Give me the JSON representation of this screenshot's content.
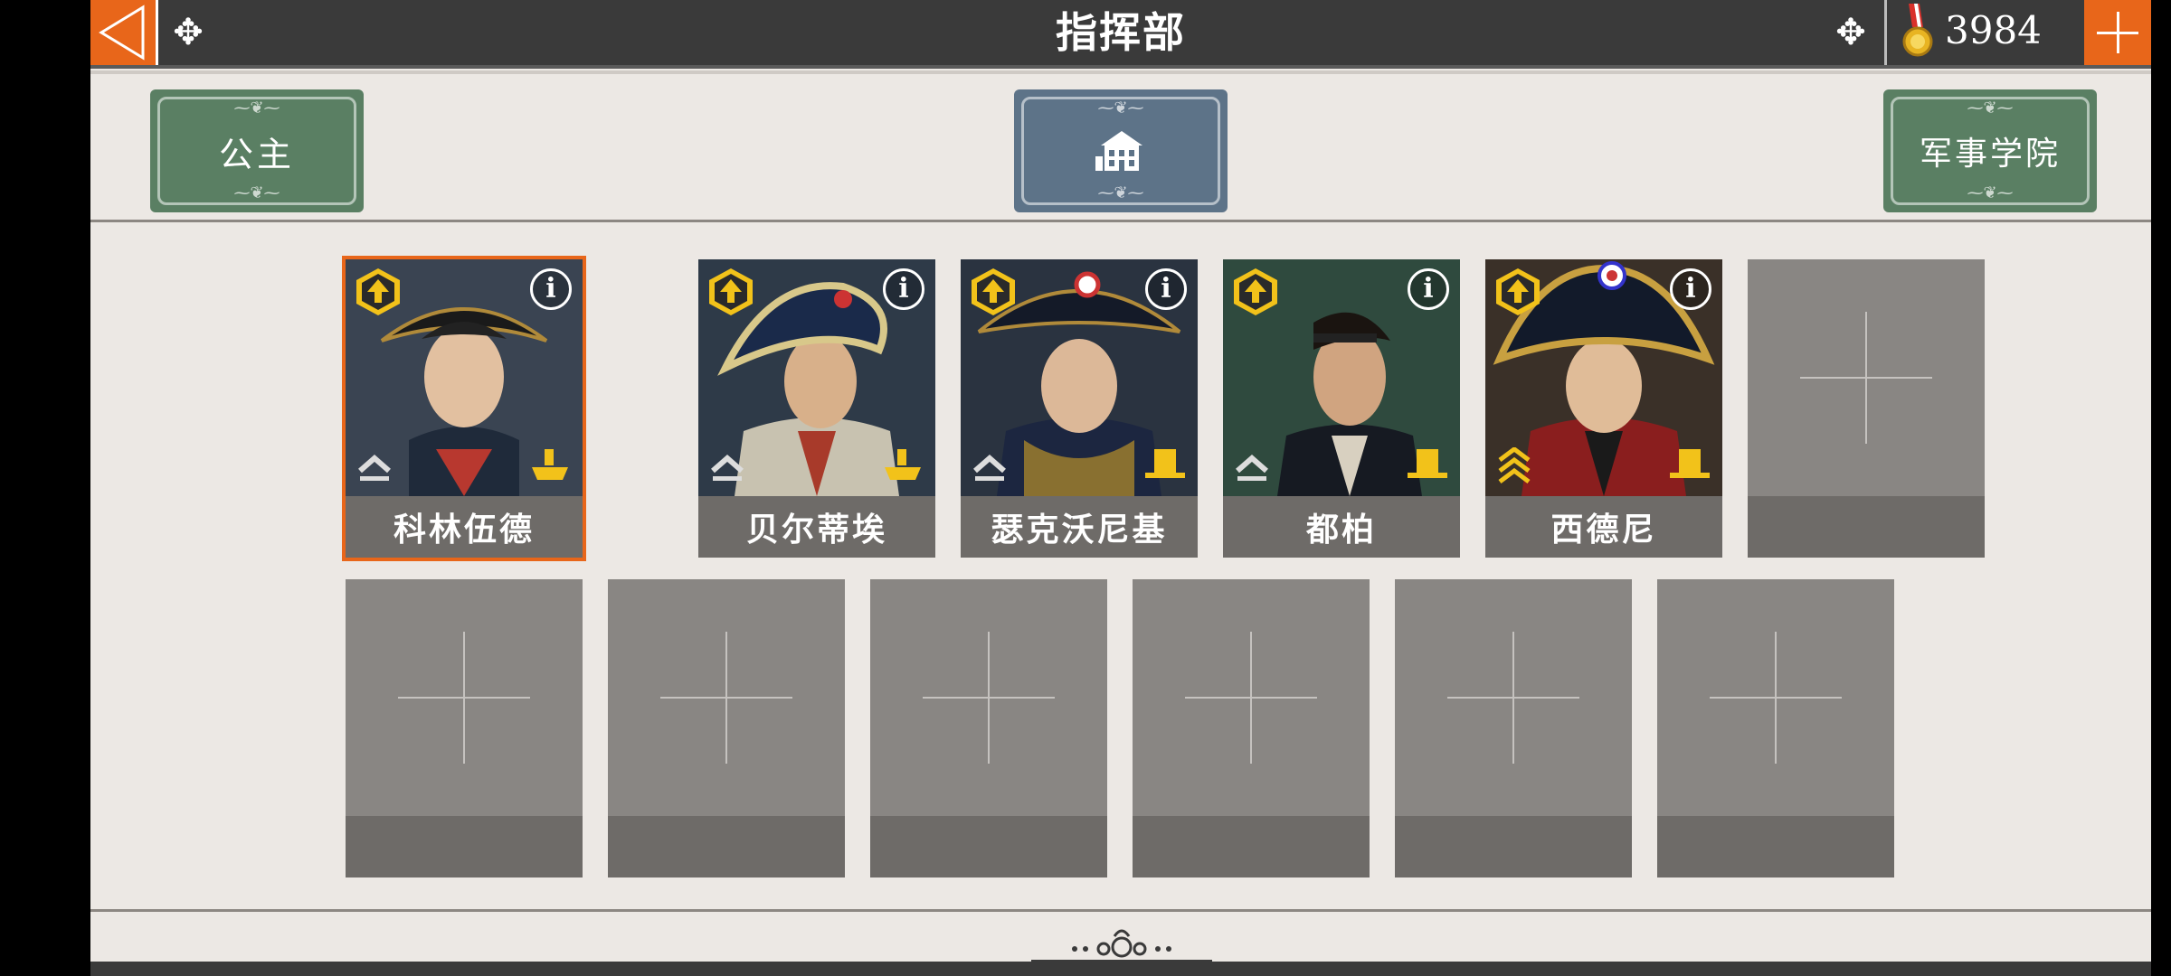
{
  "header": {
    "title": "指挥部",
    "gold_amount": "3984",
    "back_icon": "back-arrow-icon",
    "add_icon": "plus-icon",
    "medal_icon": "gold-medal-icon"
  },
  "nav": {
    "left_button": "公主",
    "center_icon": "building-icon",
    "right_button": "军事学院"
  },
  "generals": [
    {
      "name": "科林伍德",
      "rank": "rank-single-chevron-icon",
      "branch": "navy-ship-icon",
      "selected": true
    },
    {
      "name": "贝尔蒂埃",
      "rank": "rank-single-chevron-icon",
      "branch": "navy-ship-icon",
      "selected": false
    },
    {
      "name": "瑟克沃尼基",
      "rank": "rank-single-chevron-icon",
      "branch": "army-hat-icon",
      "selected": false
    },
    {
      "name": "都柏",
      "rank": "rank-single-chevron-icon",
      "branch": "army-hat-icon",
      "selected": false
    },
    {
      "name": "西德尼",
      "rank": "rank-triple-chevron-icon",
      "branch": "army-hat-icon",
      "selected": false
    }
  ],
  "empty_slots": 7,
  "colors": {
    "accent": "#e8661a",
    "topbar": "#3a3a3a",
    "background": "#ece8e4",
    "green_button": "#5a7f63",
    "slate_button": "#5d7388",
    "badge_gold": "#f2c21a"
  }
}
